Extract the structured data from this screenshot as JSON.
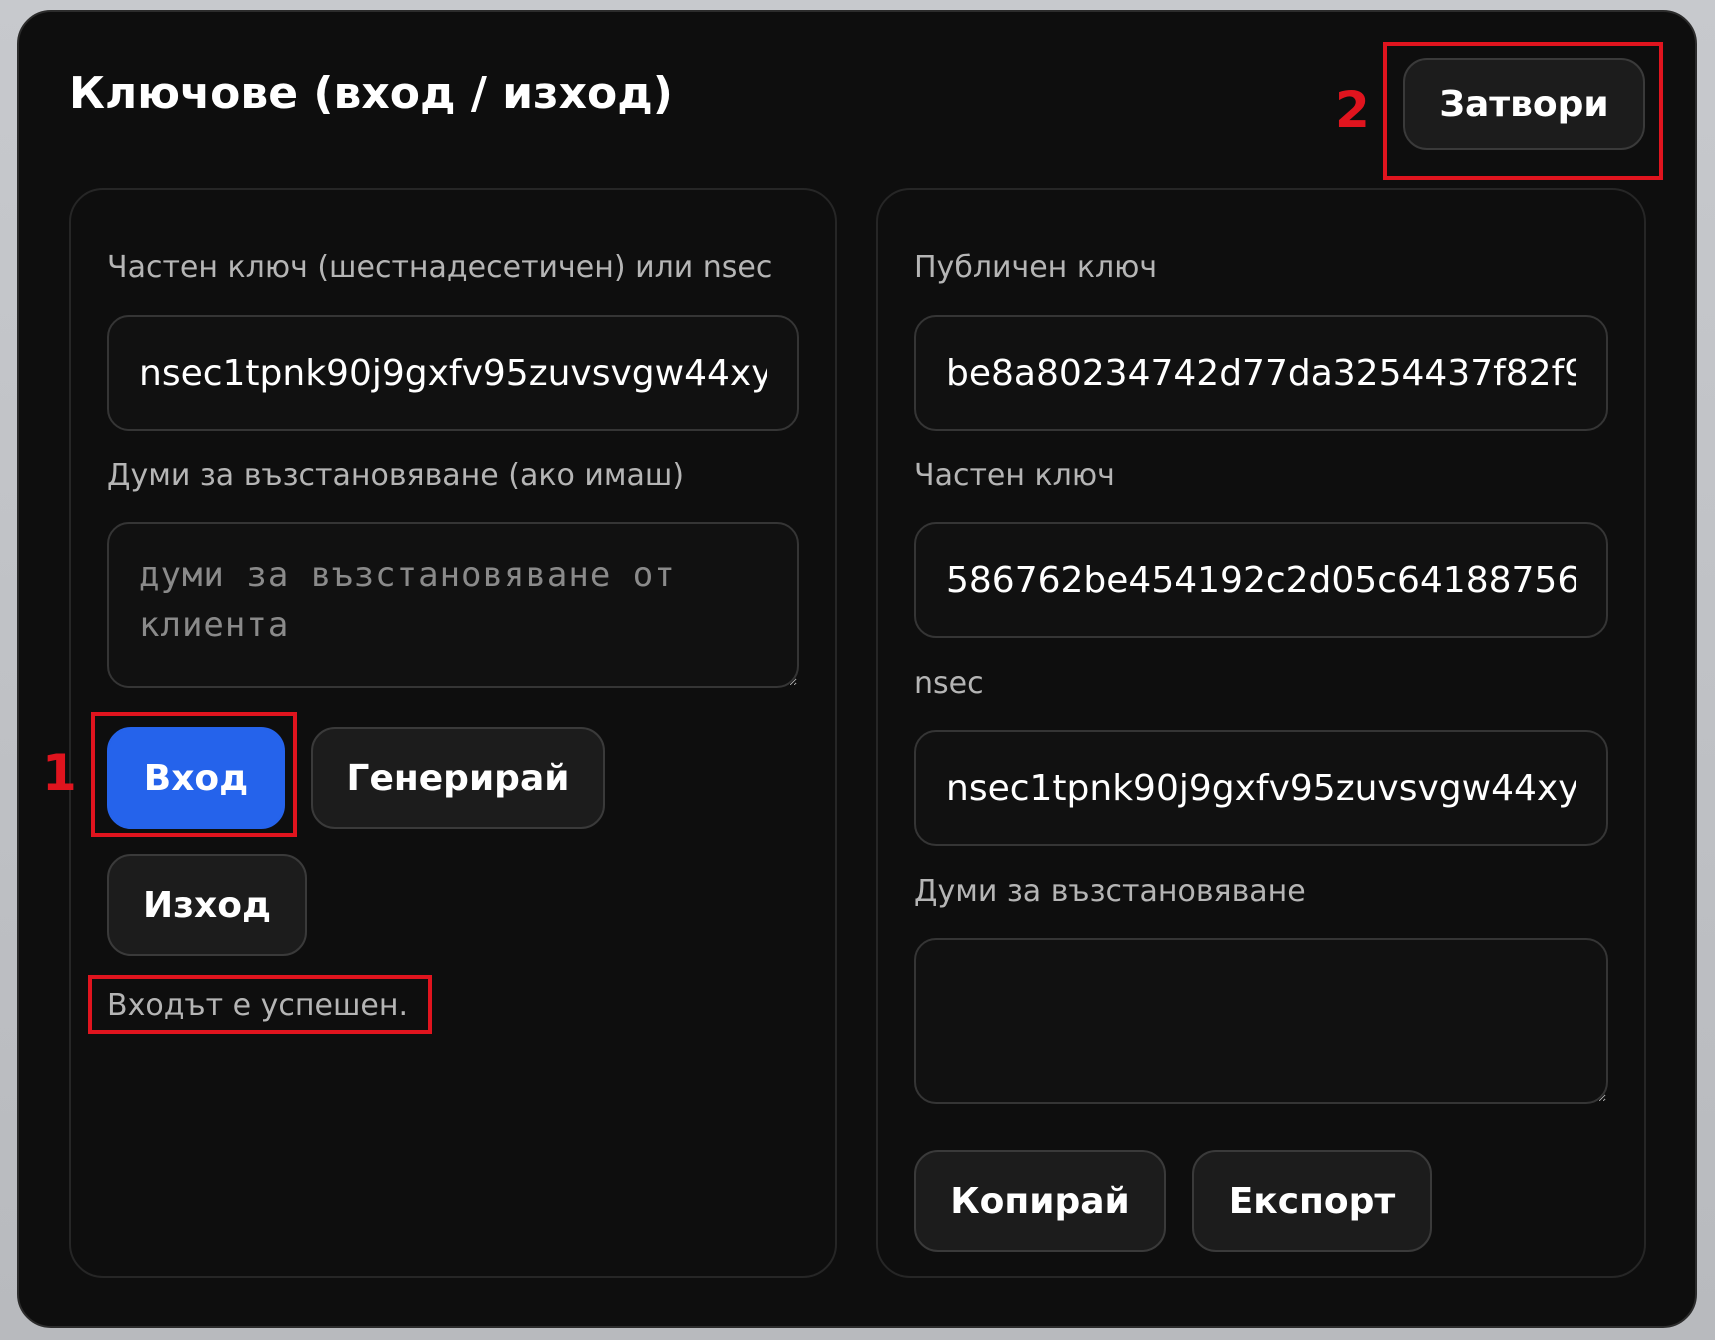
{
  "dialog": {
    "title": "Ключове (вход / изход)",
    "close_label": "Затвори"
  },
  "login_panel": {
    "private_key_label": "Частен ключ (шестнадесетичен) или nsec",
    "private_key_value": "nsec1tpnk90j9gxfv95zuvsvgw44xy",
    "mnemonic_label": "Думи за възстановяване (ако имаш)",
    "mnemonic_placeholder": "думи за възстановяване от клиента",
    "login_label": "Вход",
    "generate_label": "Генерирай",
    "logout_label": "Изход",
    "status": "Входът е успешен."
  },
  "keys_panel": {
    "public_key_label": "Публичен ключ",
    "public_key_value": "be8a80234742d77da3254437f82f9",
    "private_key_label": "Частен ключ",
    "private_key_value": "586762be454192c2d05c64188756",
    "nsec_label": "nsec",
    "nsec_value": "nsec1tpnk90j9gxfv95zuvsvgw44xy",
    "mnemonic_label": "Думи за възстановяване",
    "mnemonic_value": "",
    "copy_label": "Копирай",
    "export_label": "Експорт"
  },
  "annotations": {
    "marker_1": "1",
    "marker_2": "2"
  },
  "colors": {
    "background": "#0e0e0e",
    "accent": "#2563eb",
    "annotation": "#e0141e"
  }
}
